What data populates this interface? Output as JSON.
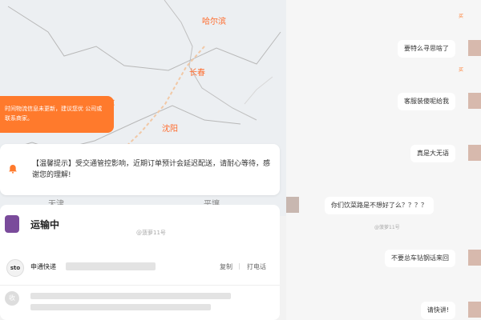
{
  "map": {
    "cities": [
      "哈尔滨",
      "长春",
      "沈阳",
      "天津",
      "平壤"
    ],
    "notice_bubble_text": "时间物流信息未更新，建议您优\n公司或联系商家。"
  },
  "notice": {
    "text": "【温馨提示】受交通管控影响，近期订单预计会延迟配送，请耐心等待，感谢您的理解!"
  },
  "shipment": {
    "status": "运输中",
    "watermark": "@菠萝11号",
    "courier": "申通快递",
    "courier_logo": "sto",
    "copy_label": "复制",
    "call_label": "打电话",
    "collect_label": "收"
  },
  "chat": {
    "watermark": "@菠萝11号",
    "messages": [
      {
        "text": "要特么寻思啥了",
        "side": "right"
      },
      {
        "text": "客服装傻呢给我",
        "side": "right"
      },
      {
        "text": "真是大无语",
        "side": "right"
      },
      {
        "text": "你们饮菜路是不想好了么？？？？",
        "side": "left"
      },
      {
        "text": "不要总车钻钢话来回",
        "side": "right"
      },
      {
        "text": "请快讲!",
        "side": "right"
      }
    ],
    "tags": [
      "买",
      "买"
    ]
  },
  "colors": {
    "accent": "#ff7a2c"
  }
}
